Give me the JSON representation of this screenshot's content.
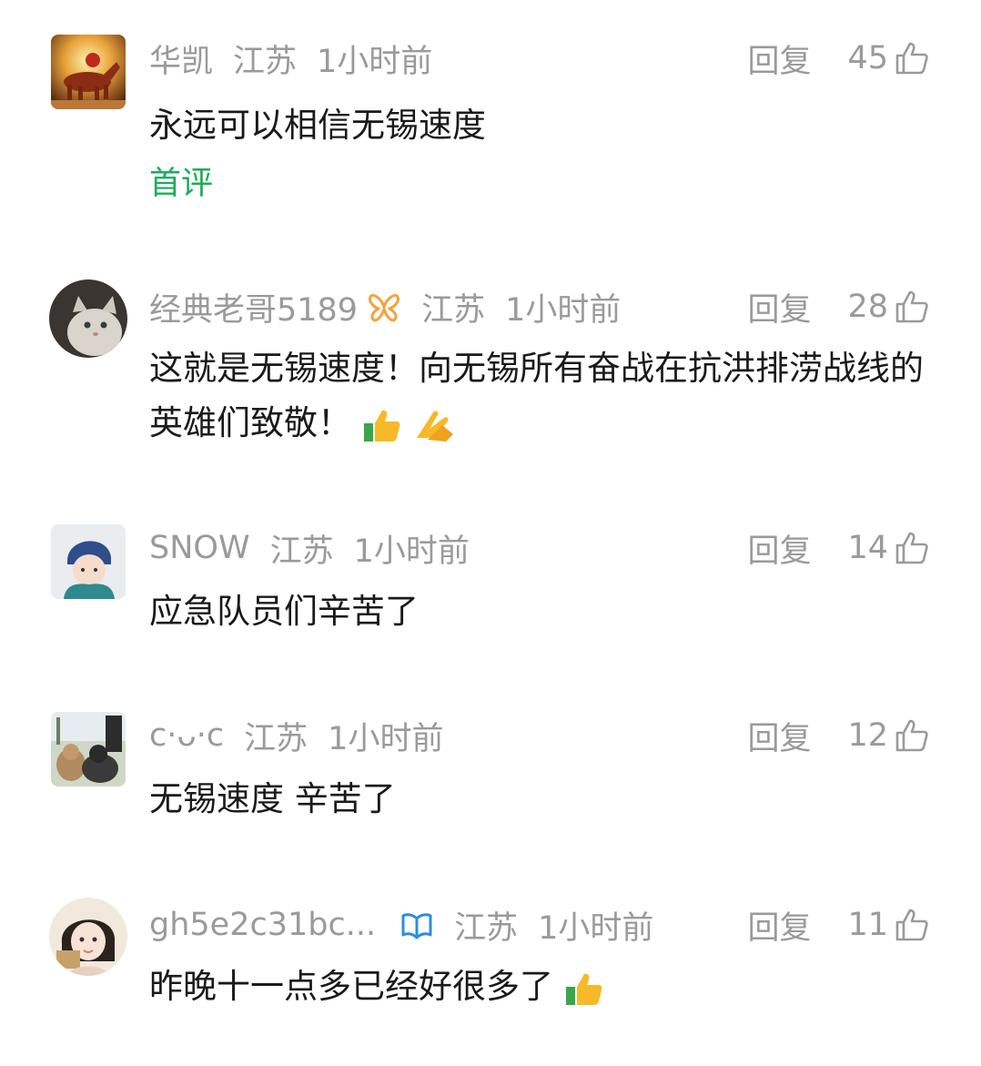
{
  "comments": [
    {
      "user": "华凯",
      "region": "江苏",
      "time": "1小时前",
      "reply": "回复",
      "likes": "45",
      "text": "永远可以相信无锡速度",
      "tag": "首评",
      "avatar_desc": "horse-painting-avatar"
    },
    {
      "user": "经典老哥5189",
      "region": "江苏",
      "time": "1小时前",
      "reply": "回复",
      "likes": "28",
      "text": "这就是无锡速度！向无锡所有奋战在抗洪排涝战线的英雄们致敬！",
      "avatar_desc": "cat-avatar"
    },
    {
      "user": "SNOW",
      "region": "江苏",
      "time": "1小时前",
      "reply": "回复",
      "likes": "14",
      "text": "应急队员们辛苦了",
      "avatar_desc": "child-avatar"
    },
    {
      "user": "c·ᴗ·c",
      "region": "江苏",
      "time": "1小时前",
      "reply": "回复",
      "likes": "12",
      "text": "无锡速度 辛苦了",
      "avatar_desc": "photo-avatar"
    },
    {
      "user": "gh5e2c31bc...",
      "region": "江苏",
      "time": "1小时前",
      "reply": "回复",
      "likes": "11",
      "text": "昨晚十一点多已经好很多了",
      "avatar_desc": "girl-avatar"
    }
  ],
  "colors": {
    "meta": "#9a9a9a",
    "text": "#1a1a1a",
    "first_tag": "#1aad5a",
    "badge_orange": "#f2a33a",
    "badge_blue": "#2c8de0"
  }
}
